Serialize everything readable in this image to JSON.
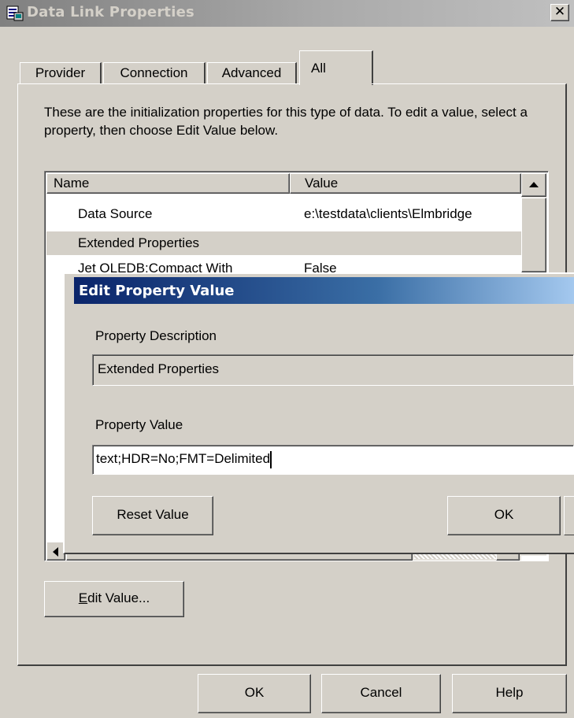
{
  "window": {
    "title": "Data Link Properties",
    "close_glyph": "✕",
    "icon": "data-link-icon"
  },
  "tabs": [
    {
      "label": "Provider",
      "active": false
    },
    {
      "label": "Connection",
      "active": false
    },
    {
      "label": "Advanced",
      "active": false
    },
    {
      "label": "All",
      "active": true
    }
  ],
  "intro": "These are the initialization properties for this type of data. To edit a value, select a property, then choose Edit Value below.",
  "list": {
    "columns": [
      "Name",
      "Value"
    ],
    "rows": [
      {
        "name": "Data Source",
        "value": "e:\\testdata\\clients\\Elmbridge"
      },
      {
        "name": "Extended Properties",
        "value": ""
      },
      {
        "name": "Jet OLEDB:Compact With",
        "value": "False"
      }
    ]
  },
  "edit_value_button": {
    "prefix": "E",
    "rest": "dit Value..."
  },
  "dialog": {
    "title": "Edit Property Value",
    "description_label": "Property Description",
    "description_value": "Extended Properties",
    "value_label": "Property Value",
    "value": "text;HDR=No;FMT=Delimited",
    "reset_label": "Reset Value",
    "ok_label": "OK"
  },
  "footer": {
    "ok_label": "OK",
    "cancel_label": "Cancel",
    "help_label": "Help"
  },
  "colors": {
    "face": "#d4d0c8",
    "active_title_start": "#0a246a",
    "active_title_end": "#a6caf0",
    "selection_row": "#d4d0c8"
  }
}
